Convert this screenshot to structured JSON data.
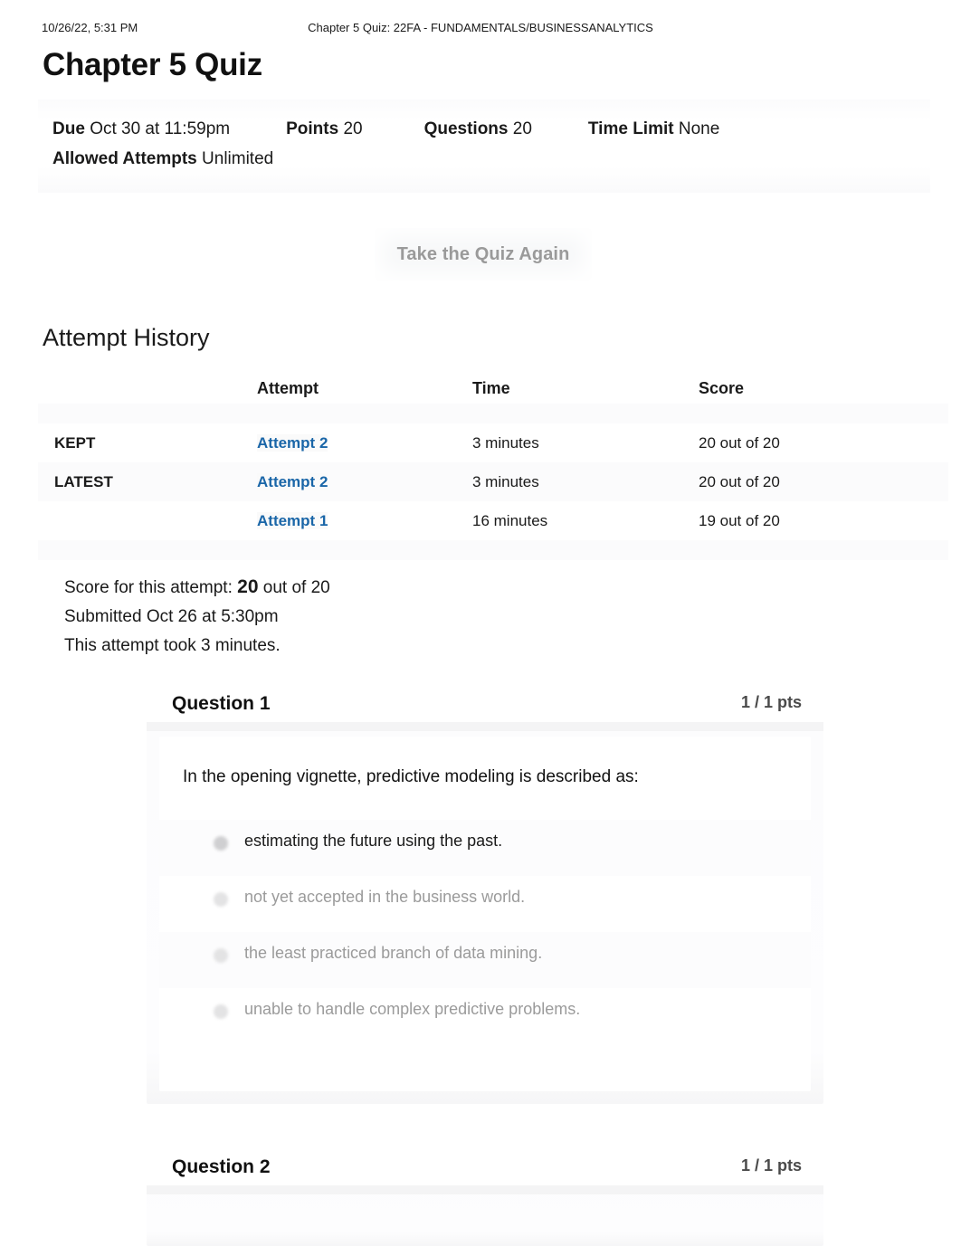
{
  "print_header": {
    "date": "10/26/22, 5:31 PM",
    "title": "Chapter 5 Quiz: 22FA - FUNDAMENTALS/BUSINESSANALYTICS"
  },
  "page_title": "Chapter 5 Quiz",
  "quiz_meta": {
    "due_label": "Due",
    "due_value": "Oct 30 at 11:59pm",
    "points_label": "Points",
    "points_value": "20",
    "questions_label": "Questions",
    "questions_value": "20",
    "time_limit_label": "Time Limit",
    "time_limit_value": "None",
    "allowed_attempts_label": "Allowed Attempts",
    "allowed_attempts_value": "Unlimited"
  },
  "retake_button": {
    "label": "Take the Quiz Again"
  },
  "attempt_history": {
    "heading": "Attempt History",
    "columns": [
      "",
      "Attempt",
      "Time",
      "Score"
    ],
    "rows": [
      {
        "label": "KEPT",
        "attempt": "Attempt 2",
        "time": "3 minutes",
        "score": "20 out of 20"
      },
      {
        "label": "LATEST",
        "attempt": "Attempt 2",
        "time": "3 minutes",
        "score": "20 out of 20"
      },
      {
        "label": "",
        "attempt": "Attempt 1",
        "time": "16 minutes",
        "score": "19 out of 20"
      }
    ]
  },
  "score_summary": {
    "score_prefix": "Score for this attempt:",
    "score_value": "20",
    "score_suffix": "out of 20",
    "submitted": "Submitted Oct 26 at 5:30pm",
    "duration": "This attempt took 3 minutes."
  },
  "questions": [
    {
      "name": "Question 1",
      "points": "1 / 1 pts",
      "text": "In the opening vignette, predictive modeling is described as:",
      "answers": [
        {
          "text": "estimating the future using the past.",
          "selected": true
        },
        {
          "text": "not yet accepted in the business world.",
          "selected": false
        },
        {
          "text": "the least practiced branch of data mining.",
          "selected": false
        },
        {
          "text": "unable to handle complex predictive problems.",
          "selected": false
        }
      ]
    },
    {
      "name": "Question 2",
      "points": "1 / 1 pts",
      "text": "",
      "answers": []
    }
  ],
  "colors": {
    "link_blue": "#1a66a8",
    "text_dark": "#1a1a1a",
    "muted_gray": "#9b9b9b",
    "points_gray": "#4a4a4a",
    "card_bg": "#f7f7f8"
  }
}
